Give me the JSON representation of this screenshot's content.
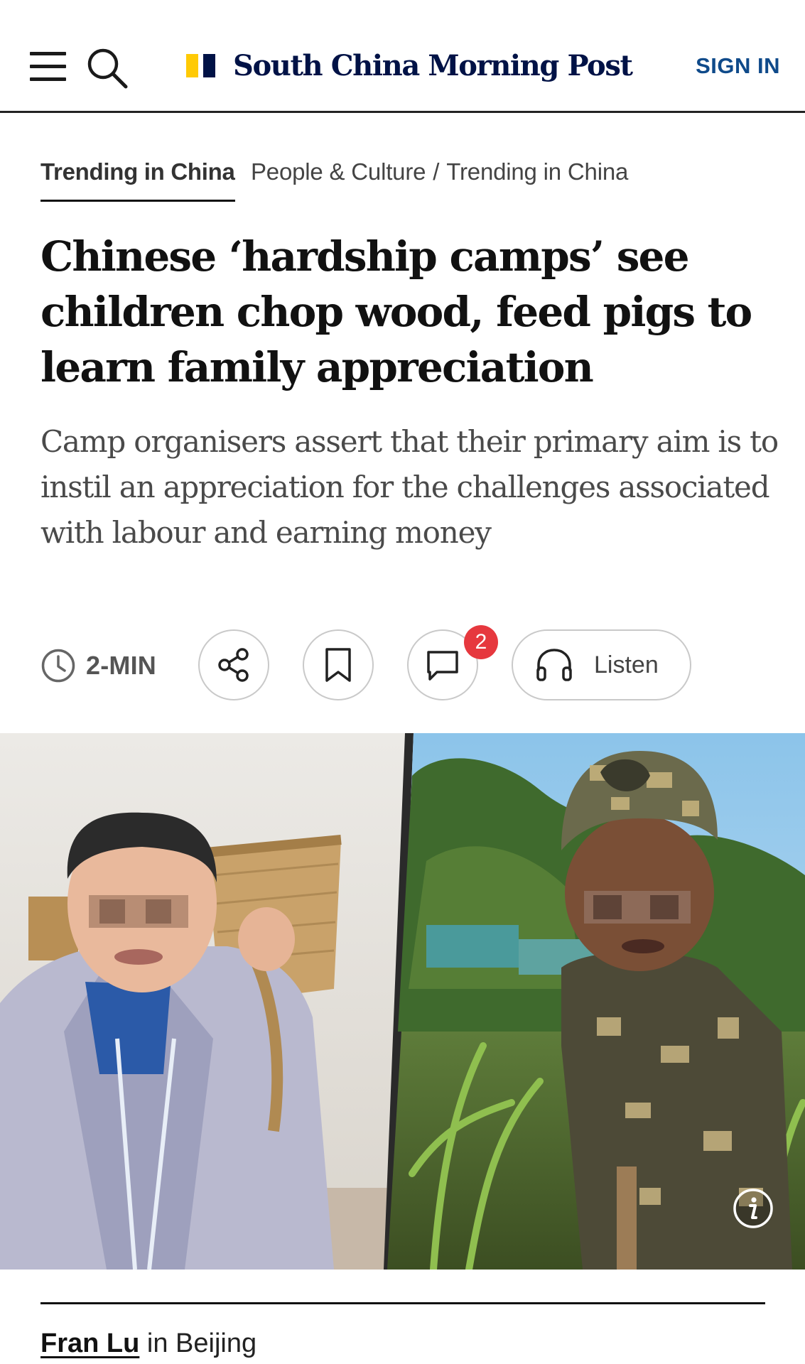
{
  "header": {
    "brand": "South China Morning Post",
    "sign_in": "SIGN IN",
    "brand_colors": {
      "navy": "#001246",
      "yellow": "#FFCA05"
    }
  },
  "breadcrumbs": {
    "primary": "Trending in China",
    "path": [
      "People & Culture",
      "Trending in China"
    ],
    "separator": "/"
  },
  "article": {
    "headline": "Chinese ‘hardship camps’ see children chop wood, feed pigs to learn family appreciation",
    "subhead": "Camp organisers assert that their primary aim is to instil an appreciation for the challenges associated with labour and earning money"
  },
  "actions": {
    "read_time": "2-MIN",
    "comment_count": "2",
    "listen_label": "Listen",
    "icons": [
      "clock-icon",
      "share-icon",
      "bookmark-icon",
      "comment-icon",
      "headphones-icon"
    ]
  },
  "hero": {
    "icons": [
      "info-icon"
    ]
  },
  "byline": {
    "author": "Fran Lu",
    "location": "in Beijing"
  }
}
